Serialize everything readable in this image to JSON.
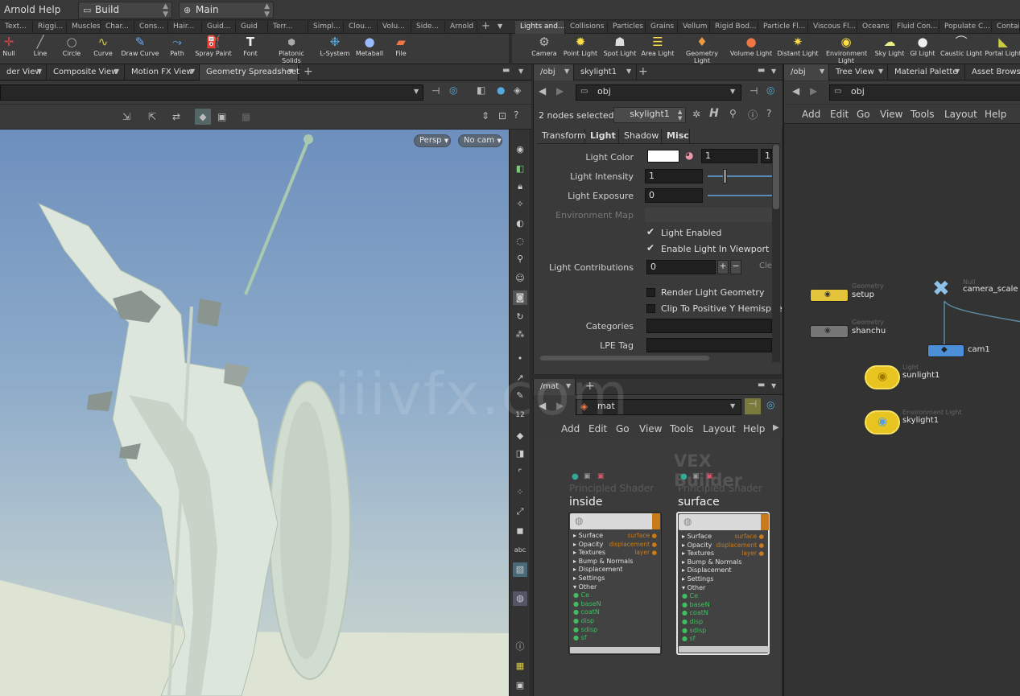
{
  "menubar": {
    "items": [
      "Arnold",
      "Help"
    ],
    "desktop": "Build",
    "network": "Main"
  },
  "shelf_tabs_left": [
    "Text...",
    "Riggi...",
    "Muscles",
    "Char...",
    "Cons...",
    "Hair...",
    "Guid...",
    "Guid",
    "Terr...",
    "Simpl...",
    "Clou...",
    "Volu...",
    "Side...",
    "Arnold"
  ],
  "shelf_tabs_right": [
    "Lights and...",
    "Collisions",
    "Particles",
    "Grains",
    "Vellum",
    "Rigid Bod...",
    "Particle Fl...",
    "Viscous Fl...",
    "Oceans",
    "Fluid Con...",
    "Populate C...",
    "Contai"
  ],
  "tools_left": [
    {
      "label": "Null",
      "icon": "null-icon"
    },
    {
      "label": "Line",
      "icon": "line-icon"
    },
    {
      "label": "Circle",
      "icon": "circle-icon"
    },
    {
      "label": "Curve",
      "icon": "curve-icon"
    },
    {
      "label": "Draw Curve",
      "icon": "draw-curve-icon"
    },
    {
      "label": "Path",
      "icon": "path-icon"
    },
    {
      "label": "Spray Paint",
      "icon": "spray-paint-icon"
    },
    {
      "label": "Font",
      "icon": "font-icon"
    },
    {
      "label": "Platonic Solids",
      "icon": "platonic-solids-icon"
    },
    {
      "label": "L-System",
      "icon": "l-system-icon"
    },
    {
      "label": "Metaball",
      "icon": "metaball-icon"
    },
    {
      "label": "File",
      "icon": "file-icon"
    }
  ],
  "tools_right": [
    {
      "label": "Camera",
      "icon": "camera-icon"
    },
    {
      "label": "Point Light",
      "icon": "point-light-icon"
    },
    {
      "label": "Spot Light",
      "icon": "spot-light-icon"
    },
    {
      "label": "Area Light",
      "icon": "area-light-icon"
    },
    {
      "label": "Geometry Light",
      "icon": "geometry-light-icon"
    },
    {
      "label": "Volume Light",
      "icon": "volume-light-icon"
    },
    {
      "label": "Distant Light",
      "icon": "distant-light-icon"
    },
    {
      "label": "Environment Light",
      "icon": "environment-light-icon"
    },
    {
      "label": "Sky Light",
      "icon": "sky-light-icon"
    },
    {
      "label": "GI Light",
      "icon": "gi-light-icon"
    },
    {
      "label": "Caustic Light",
      "icon": "caustic-light-icon"
    },
    {
      "label": "Portal Light",
      "icon": "portal-light-icon"
    }
  ],
  "viewer": {
    "tabs": [
      "der View",
      "Composite View",
      "Motion FX View",
      "Geometry Spreadsheet"
    ],
    "persp": "Persp",
    "cam": "No cam"
  },
  "params": {
    "tabs": [
      "/obj",
      "skylight1"
    ],
    "path": "obj",
    "selected": "2 nodes selected:",
    "node": "skylight1",
    "subtabs": [
      "Transform",
      "Light",
      "Shadow",
      "Misc"
    ],
    "light_color_label": "Light Color",
    "light_color_val": "1",
    "light_color_val2": "1",
    "intensity_label": "Light Intensity",
    "intensity_val": "1",
    "exposure_label": "Light Exposure",
    "exposure_val": "0",
    "env_map_label": "Environment Map",
    "light_enabled": "Light Enabled",
    "enable_viewport": "Enable Light In Viewport",
    "contrib_label": "Light Contributions",
    "contrib_val": "0",
    "contrib_clear": "Cle",
    "render_geo": "Render Light Geometry",
    "clip_y": "Clip To Positive Y Hemisphere",
    "categories_label": "Categories",
    "lpe_label": "LPE Tag"
  },
  "mat": {
    "tab": "/mat",
    "path": "mat",
    "menus": [
      "Add",
      "Edit",
      "Go",
      "View",
      "Tools",
      "Layout",
      "Help"
    ],
    "builder": "VEX Builder",
    "nodes": [
      {
        "type": "Principled Shader",
        "name": "inside"
      },
      {
        "type": "Principled Shader",
        "name": "surface"
      }
    ],
    "inputs": [
      "Surface",
      "Opacity",
      "Textures",
      "Bump & Normals",
      "Displacement",
      "Settings",
      "Other"
    ],
    "extras": [
      "Ce",
      "baseN",
      "coatN",
      "disp",
      "sdisp",
      "sf"
    ],
    "outputs": [
      "surface",
      "displacement",
      "layer"
    ]
  },
  "net": {
    "tabs": [
      "/obj",
      "Tree View",
      "Material Palette",
      "Asset Browser"
    ],
    "path": "obj",
    "menus": [
      "Add",
      "Edit",
      "Go",
      "View",
      "Tools",
      "Layout",
      "Help"
    ],
    "nodes": [
      {
        "type": "Geometry",
        "name": "setup"
      },
      {
        "type": "Geometry",
        "name": "shanchu"
      },
      {
        "type": "Null",
        "name": "camera_scale"
      },
      {
        "type": "",
        "name": "cam1"
      },
      {
        "type": "Light",
        "name": "sunlight1"
      },
      {
        "type": "Environment Light",
        "name": "skylight1"
      }
    ]
  },
  "watermark": "iiivfx.com",
  "colors": {
    "accent_orange": "#c97a1a",
    "light_node_yellow": "#e8c420",
    "cam_blue": "#4a8fd8",
    "geo_yellow": "#e3c43a"
  }
}
